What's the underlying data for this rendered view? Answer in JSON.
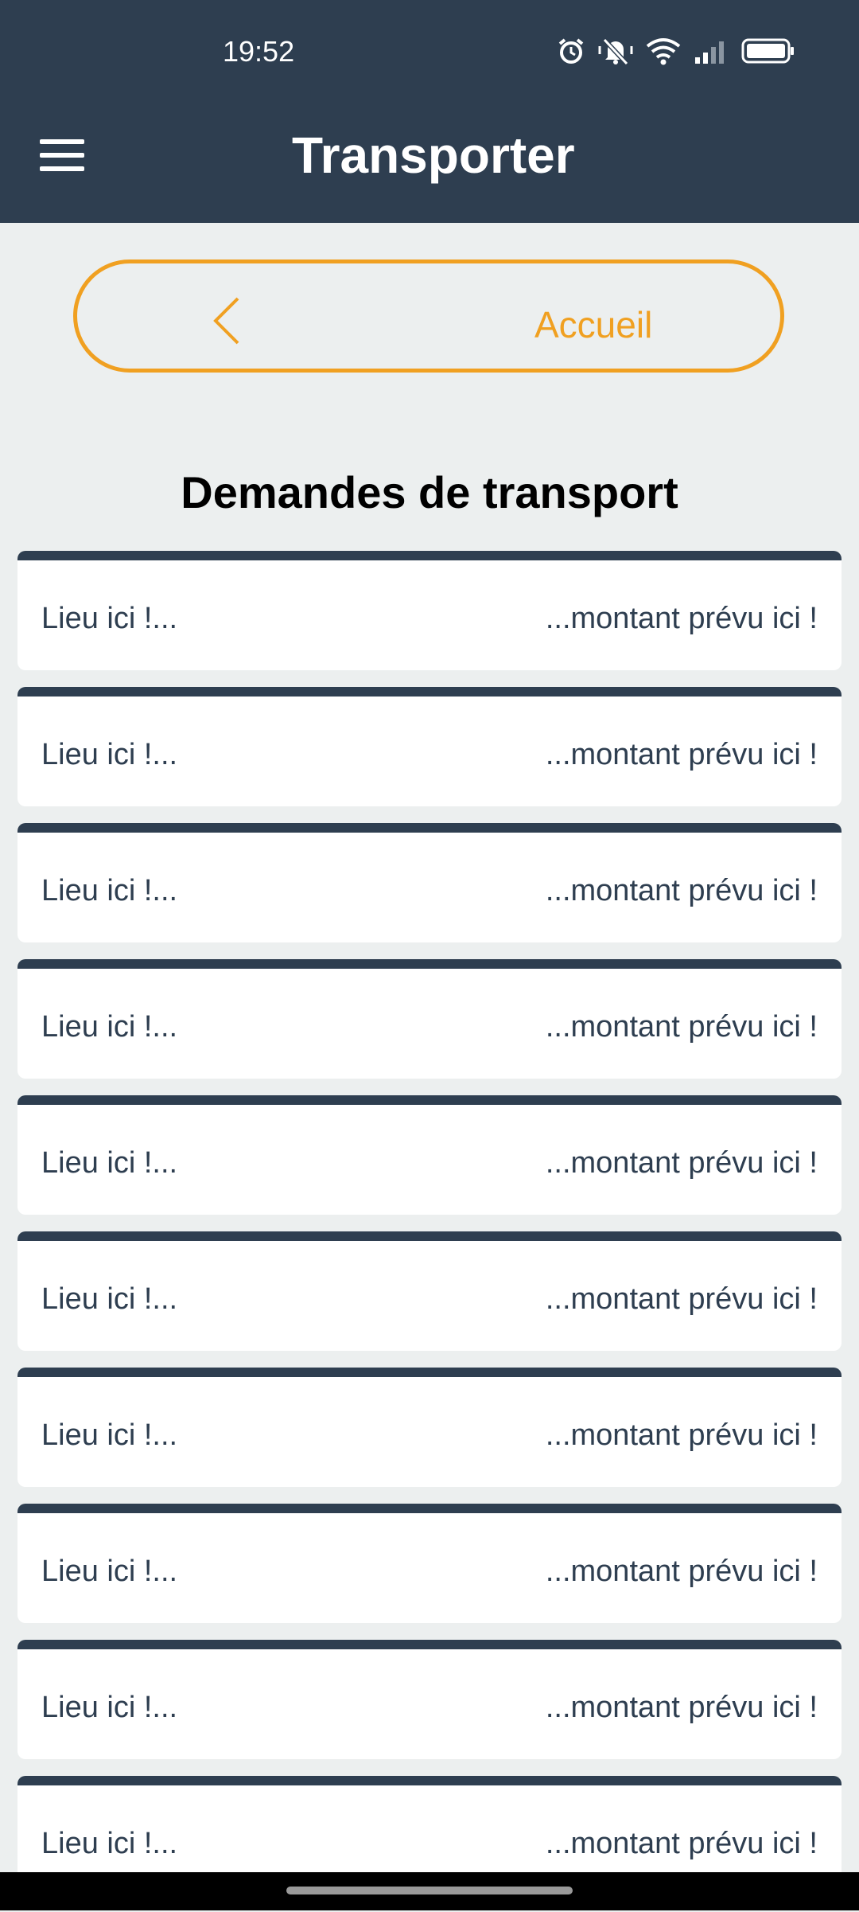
{
  "status_bar": {
    "time": "19:52",
    "icons": [
      "alarm-icon",
      "mute-icon",
      "wifi-icon",
      "signal-icon",
      "battery-icon"
    ]
  },
  "header": {
    "menu_icon": "hamburger-icon",
    "title": "Transporter"
  },
  "home_button": {
    "icon": "chevron-left-icon",
    "label": "Accueil"
  },
  "section": {
    "title": "Demandes de transport"
  },
  "requests": [
    {
      "place": "Lieu ici !...",
      "amount": "...montant prévu ici !"
    },
    {
      "place": "Lieu ici !...",
      "amount": "...montant prévu ici !"
    },
    {
      "place": "Lieu ici !...",
      "amount": "...montant prévu ici !"
    },
    {
      "place": "Lieu ici !...",
      "amount": "...montant prévu ici !"
    },
    {
      "place": "Lieu ici !...",
      "amount": "...montant prévu ici !"
    },
    {
      "place": "Lieu ici !...",
      "amount": "...montant prévu ici !"
    },
    {
      "place": "Lieu ici !...",
      "amount": "...montant prévu ici !"
    },
    {
      "place": "Lieu ici !...",
      "amount": "...montant prévu ici !"
    },
    {
      "place": "Lieu ici !...",
      "amount": "...montant prévu ici !"
    },
    {
      "place": "Lieu ici !...",
      "amount": "...montant prévu ici !"
    }
  ],
  "colors": {
    "header": "#2e3e50",
    "accent": "#f0a021",
    "background": "#ecefef",
    "card": "#ffffff",
    "text": "#2e3e50"
  }
}
